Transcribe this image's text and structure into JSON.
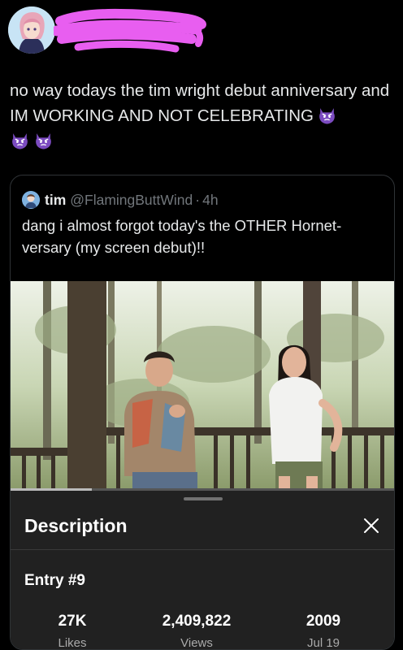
{
  "post": {
    "text": "no way todays the tim wright debut anniversary and IM WORKING AND NOT CELEBRATING",
    "emoji": "angry-devil-emoji"
  },
  "quote": {
    "name": "tim",
    "handle": "@FlamingButtWind",
    "separator": "·",
    "time": "4h",
    "text": "dang i almost forgot today's the OTHER Hornet-versary (my screen debut)!!"
  },
  "video": {
    "progress": 0.21
  },
  "description": {
    "title": "Description",
    "entry": "Entry #9",
    "stats": [
      {
        "value": "27K",
        "label": "Likes"
      },
      {
        "value": "2,409,822",
        "label": "Views"
      },
      {
        "value": "2009",
        "label": "Jul 19"
      }
    ]
  },
  "colors": {
    "background": "#000000",
    "text": "#e7e9ea",
    "muted": "#71767b",
    "sheet": "#212121",
    "redaction": "#e85ef0",
    "emoji": "#7b4bc0"
  }
}
